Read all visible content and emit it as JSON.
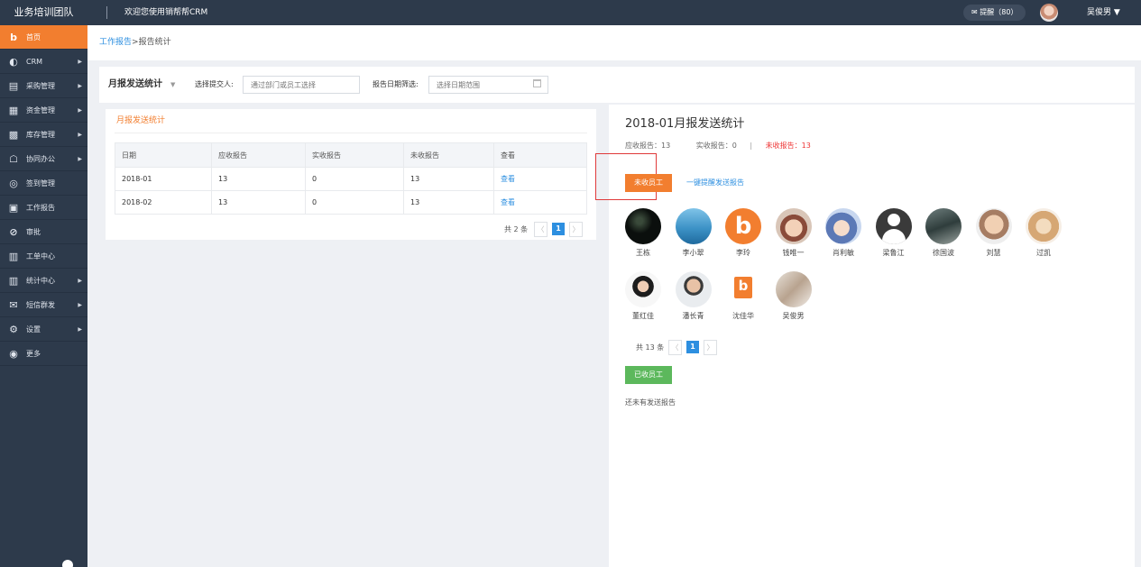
{
  "topbar": {
    "team": "业务培训团队",
    "welcome": "欢迎您使用销帮帮CRM",
    "remind": "✉ 提醒（80）",
    "user": "吴俊男 ▼"
  },
  "sidebar": {
    "items": [
      {
        "label": "首页",
        "icon": "home-logo-icon",
        "glyph": "b",
        "arrow": ""
      },
      {
        "label": "CRM",
        "icon": "crm-icon",
        "glyph": "◐",
        "arrow": "▶"
      },
      {
        "label": "采购管理",
        "icon": "purchase-icon",
        "glyph": "▤",
        "arrow": "▶"
      },
      {
        "label": "资金管理",
        "icon": "finance-icon",
        "glyph": "▦",
        "arrow": "▶"
      },
      {
        "label": "库存管理",
        "icon": "inventory-icon",
        "glyph": "▩",
        "arrow": "▶"
      },
      {
        "label": "协同办公",
        "icon": "office-icon",
        "glyph": "☖",
        "arrow": "▶"
      },
      {
        "label": "签到管理",
        "icon": "checkin-icon",
        "glyph": "◎",
        "arrow": ""
      },
      {
        "label": "工作报告",
        "icon": "report-icon",
        "glyph": "▣",
        "arrow": ""
      },
      {
        "label": "审批",
        "icon": "approval-icon",
        "glyph": "⊘",
        "arrow": ""
      },
      {
        "label": "工单中心",
        "icon": "ticket-icon",
        "glyph": "▥",
        "arrow": ""
      },
      {
        "label": "统计中心",
        "icon": "stats-icon",
        "glyph": "▥",
        "arrow": "▶"
      },
      {
        "label": "短信群发",
        "icon": "sms-icon",
        "glyph": "✉",
        "arrow": "▶"
      },
      {
        "label": "设置",
        "icon": "settings-icon",
        "glyph": "⚙",
        "arrow": "▶"
      },
      {
        "label": "更多",
        "icon": "more-icon",
        "glyph": "◉",
        "arrow": ""
      }
    ]
  },
  "breadcrumb": {
    "link": "工作报告",
    "sep": ">",
    "current": "报告统计"
  },
  "filter": {
    "title": "月报发送统计",
    "submitter_label": "选择提交人:",
    "submitter_placeholder": "通过部门或员工选择",
    "date_label": "报告日期筛选:",
    "date_placeholder": "选择日期范围"
  },
  "left_panel": {
    "title": "月报发送统计",
    "columns": [
      "日期",
      "应收报告",
      "实收报告",
      "未收报告",
      "查看"
    ],
    "rows": [
      [
        "2018-01",
        "13",
        "0",
        "13",
        "查看"
      ],
      [
        "2018-02",
        "13",
        "0",
        "13",
        "查看"
      ]
    ],
    "pager": {
      "total": "共 2 条",
      "prev": "〈",
      "current": "1",
      "next": "〉"
    }
  },
  "right_panel": {
    "title": "2018-01月报发送统计",
    "expected": "应收报告：13",
    "received": "实收报告：0",
    "sep": "|",
    "missing": "未收报告：13",
    "unreceived_button": "未收员工",
    "remind_all": "一键提醒发送报告",
    "employees": [
      {
        "name": "王栋",
        "avatar": "dark"
      },
      {
        "name": "李小翠",
        "avatar": "sea"
      },
      {
        "name": "李玲",
        "avatar": "logo"
      },
      {
        "name": "钱唯一",
        "avatar": "child"
      },
      {
        "name": "肖利敏",
        "avatar": "baby"
      },
      {
        "name": "梁鲁江",
        "avatar": "default"
      },
      {
        "name": "徐国波",
        "avatar": "car"
      },
      {
        "name": "刘慧",
        "avatar": "kid2"
      },
      {
        "name": "过凯",
        "avatar": "food"
      },
      {
        "name": "董红佳",
        "avatar": "woman"
      },
      {
        "name": "潘长青",
        "avatar": "man"
      },
      {
        "name": "沈佳华",
        "avatar": "logo-sq"
      },
      {
        "name": "吴俊男",
        "avatar": "photo"
      }
    ],
    "pager": {
      "total": "共 13 条",
      "prev": "〈",
      "current": "1",
      "next": "〉"
    },
    "received_button": "已收员工",
    "empty_message": "还未有发送报告"
  },
  "colors": {
    "sidebar": "#2d3a4b",
    "accent_orange": "#f27e2f",
    "link_blue": "#2d8fe0",
    "green": "#5cb85c",
    "red": "#e33333"
  }
}
